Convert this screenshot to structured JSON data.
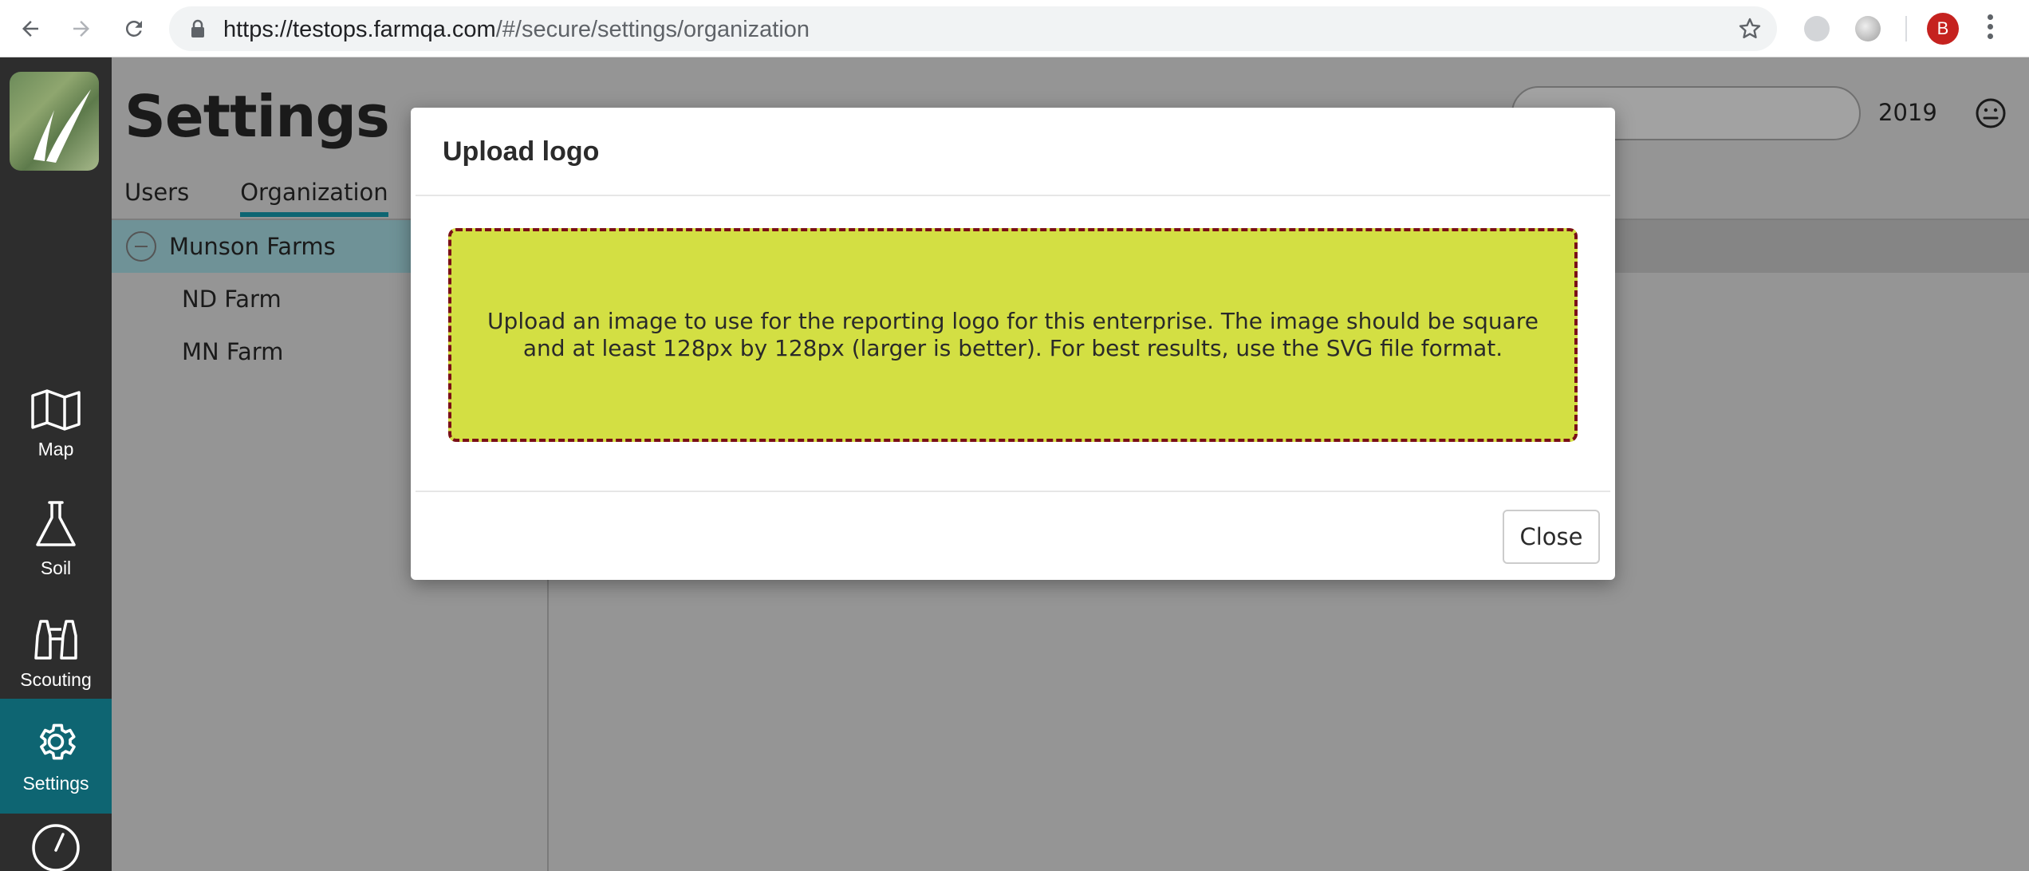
{
  "browser": {
    "url_host": "https://testops.farmqa.com",
    "url_path": "/#/secure/settings/organization",
    "profile_initial": "B"
  },
  "rail": {
    "items": [
      {
        "label": "Map",
        "icon": "map-icon"
      },
      {
        "label": "Soil",
        "icon": "flask-icon"
      },
      {
        "label": "Scouting",
        "icon": "binoculars-icon"
      },
      {
        "label": "Settings",
        "icon": "gear-icon",
        "active": true
      }
    ],
    "active_color": "#0e6572"
  },
  "page": {
    "title": "Settings",
    "tabs": [
      {
        "label": "Users",
        "active": false
      },
      {
        "label": "Organization",
        "active": true
      }
    ],
    "year": "2019"
  },
  "tree": {
    "root": "Munson Farms",
    "children": [
      "ND Farm",
      "MN Farm"
    ]
  },
  "modal": {
    "title": "Upload logo",
    "dropzone_text": "Upload an image to use for the reporting logo for this enterprise. The image should be square and at least 128px by 128px (larger is better). For best results, use the SVG file format.",
    "close_label": "Close",
    "dropzone_color": "#d3df43",
    "dropzone_border_color": "#7a0f18"
  }
}
